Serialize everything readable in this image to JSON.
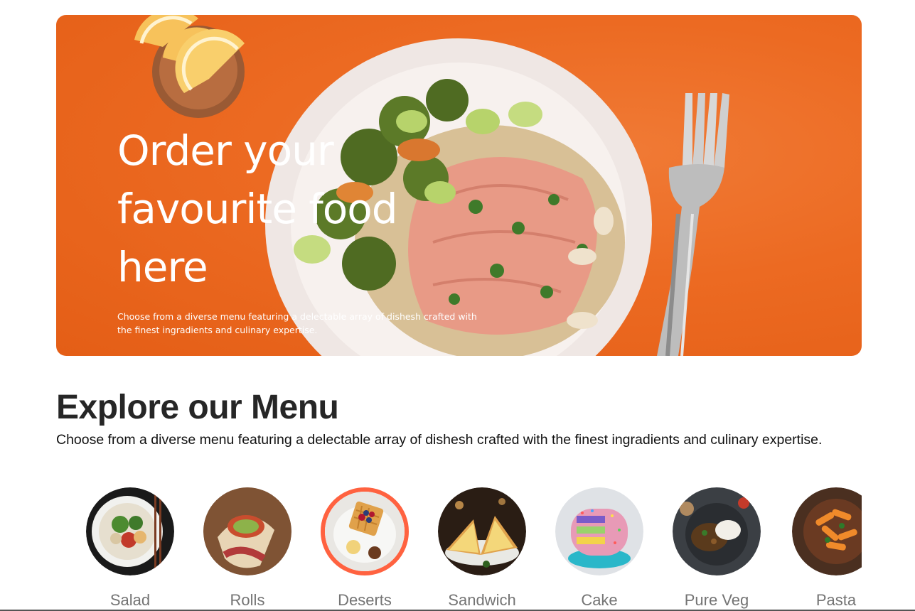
{
  "hero": {
    "title": "Order your favourite food here",
    "subtitle": "Choose from a diverse menu featuring a delectable array of dishesh crafted with the finest ingradients and culinary expertise."
  },
  "menu": {
    "title": "Explore our Menu",
    "description": "Choose from a diverse menu featuring a delectable array of dishesh crafted with the finest ingradients and culinary expertise.",
    "items": [
      {
        "label": "Salad",
        "icon": "salad-bowl-image",
        "active": false
      },
      {
        "label": "Rolls",
        "icon": "rolls-wrap-image",
        "active": false
      },
      {
        "label": "Deserts",
        "icon": "waffle-dessert-image",
        "active": true
      },
      {
        "label": "Sandwich",
        "icon": "sandwich-image",
        "active": false
      },
      {
        "label": "Cake",
        "icon": "cake-image",
        "active": false
      },
      {
        "label": "Pure Veg",
        "icon": "veg-curry-image",
        "active": false
      },
      {
        "label": "Pasta",
        "icon": "pasta-image",
        "active": false
      }
    ]
  },
  "colors": {
    "hero_orange": "#ec6a22",
    "active_ring": "#ff6240",
    "heading": "#262626",
    "label": "#747474"
  }
}
